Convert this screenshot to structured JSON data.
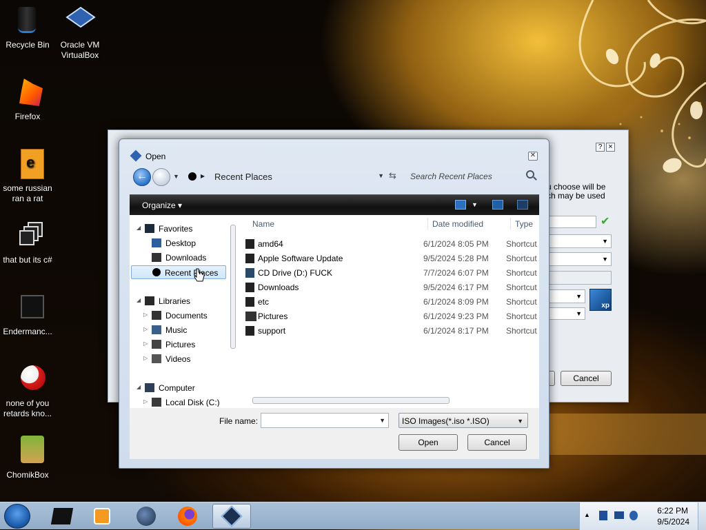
{
  "desktop": {
    "icons": [
      {
        "label_line1": "Recycle Bin",
        "label_line2": ""
      },
      {
        "label_line1": "Oracle VM",
        "label_line2": "VirtualBox"
      },
      {
        "label_line1": "Firefox",
        "label_line2": ""
      },
      {
        "label_line1": "some russian",
        "label_line2": "ran a rat"
      },
      {
        "label_line1": "that but its c#",
        "label_line2": ""
      },
      {
        "label_line1": "Endermanc...",
        "label_line2": ""
      },
      {
        "label_line1": "none of you",
        "label_line2": "retards kno..."
      },
      {
        "label_line1": "ChomikBox",
        "label_line2": ""
      }
    ]
  },
  "background_dialog": {
    "text_line1": "u choose will be",
    "text_line2": "ch may be used",
    "cancel_label": "Cancel",
    "help_glyph": "?",
    "close_glyph": "×",
    "xp_badge": "xp"
  },
  "open_dialog": {
    "title": "Open",
    "location": "Recent Places",
    "search_placeholder": "Search Recent Places",
    "organize_label": "Organize",
    "nav_pane": {
      "favorites": "Favorites",
      "desktop": "Desktop",
      "downloads": "Downloads",
      "recent_places": "Recent Places",
      "libraries": "Libraries",
      "documents": "Documents",
      "music": "Music",
      "pictures": "Pictures",
      "videos": "Videos",
      "computer": "Computer",
      "local_disk": "Local Disk (C:)"
    },
    "columns": {
      "name": "Name",
      "date": "Date modified",
      "type": "Type"
    },
    "files": [
      {
        "name": "amd64",
        "date": "6/1/2024 8:05 PM",
        "type": "Shortcut"
      },
      {
        "name": "Apple Software Update",
        "date": "9/5/2024 5:28 PM",
        "type": "Shortcut"
      },
      {
        "name": "CD Drive (D:) FUCK",
        "date": "7/7/2024 6:07 PM",
        "type": "Shortcut"
      },
      {
        "name": "Downloads",
        "date": "9/5/2024 6:17 PM",
        "type": "Shortcut"
      },
      {
        "name": "etc",
        "date": "6/1/2024 8:09 PM",
        "type": "Shortcut"
      },
      {
        "name": "Pictures",
        "date": "6/1/2024 9:23 PM",
        "type": "Shortcut"
      },
      {
        "name": "support",
        "date": "6/1/2024 8:17 PM",
        "type": "Shortcut"
      }
    ],
    "file_name_label": "File name:",
    "file_name_value": "",
    "filter_value": "ISO Images(*.iso *.ISO)",
    "open_label": "Open",
    "cancel_label": "Cancel"
  },
  "taskbar": {
    "time": "6:22 PM",
    "date": "9/5/2024"
  },
  "icons": [
    "recycle-bin-icon",
    "virtualbox-icon",
    "firefox-icon",
    "folder-icon",
    "search-icon",
    "back-arrow-icon",
    "forward-arrow-icon",
    "refresh-icon",
    "close-icon",
    "start-orb-icon"
  ]
}
